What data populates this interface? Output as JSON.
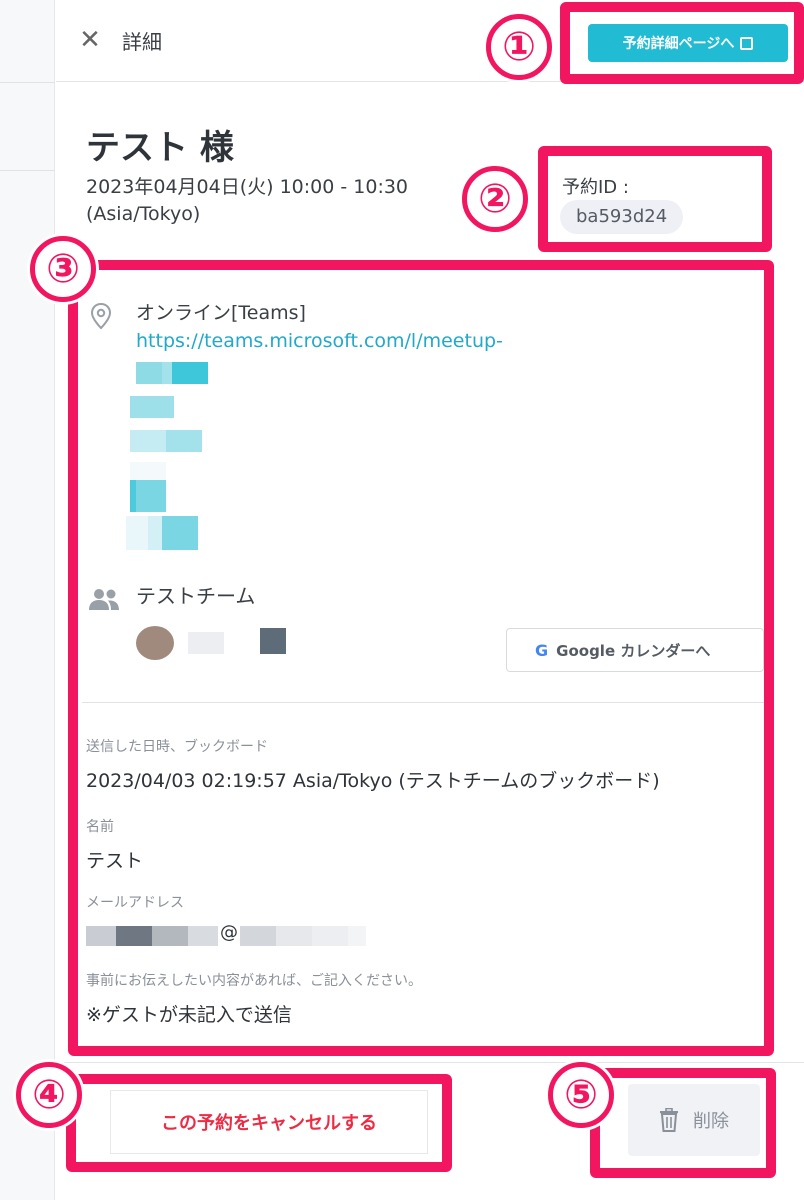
{
  "header": {
    "close_icon": "close-icon",
    "title": "詳細",
    "detail_page_button": "予約詳細ページへ",
    "detail_button_color": "#21bcd4"
  },
  "booking": {
    "name": "テスト 様",
    "datetime": "2023年04月04日(火) 10:00 - 10:30",
    "timezone": "(Asia/Tokyo)",
    "reservation_id_label": "予約ID :",
    "reservation_id": "ba593d24"
  },
  "location": {
    "icon": "map-pin-icon",
    "title": "オンライン[Teams]",
    "url": "https://teams.microsoft.com/l/meetup-"
  },
  "team": {
    "icon": "people-icon",
    "name": "テストチーム",
    "google_calendar_button": "Google カレンダーへ"
  },
  "details": {
    "sent_label": "送信した日時、ブックボード",
    "sent_value": "2023/04/03 02:19:57 Asia/Tokyo (テストチームのブックボード)",
    "name_label": "名前",
    "name_value": "テスト",
    "email_label": "メールアドレス",
    "email_at": "@",
    "note_label": "事前にお伝えしたい内容があれば、ご記入ください。",
    "note_value": "※ゲストが未記入で送信"
  },
  "actions": {
    "cancel_button": "この予約をキャンセルする",
    "delete_button": "削除",
    "cancel_color": "#ee2b44"
  },
  "annotations": {
    "color": "#f2155f",
    "numbers": [
      "①",
      "②",
      "③",
      "④",
      "⑤"
    ]
  }
}
